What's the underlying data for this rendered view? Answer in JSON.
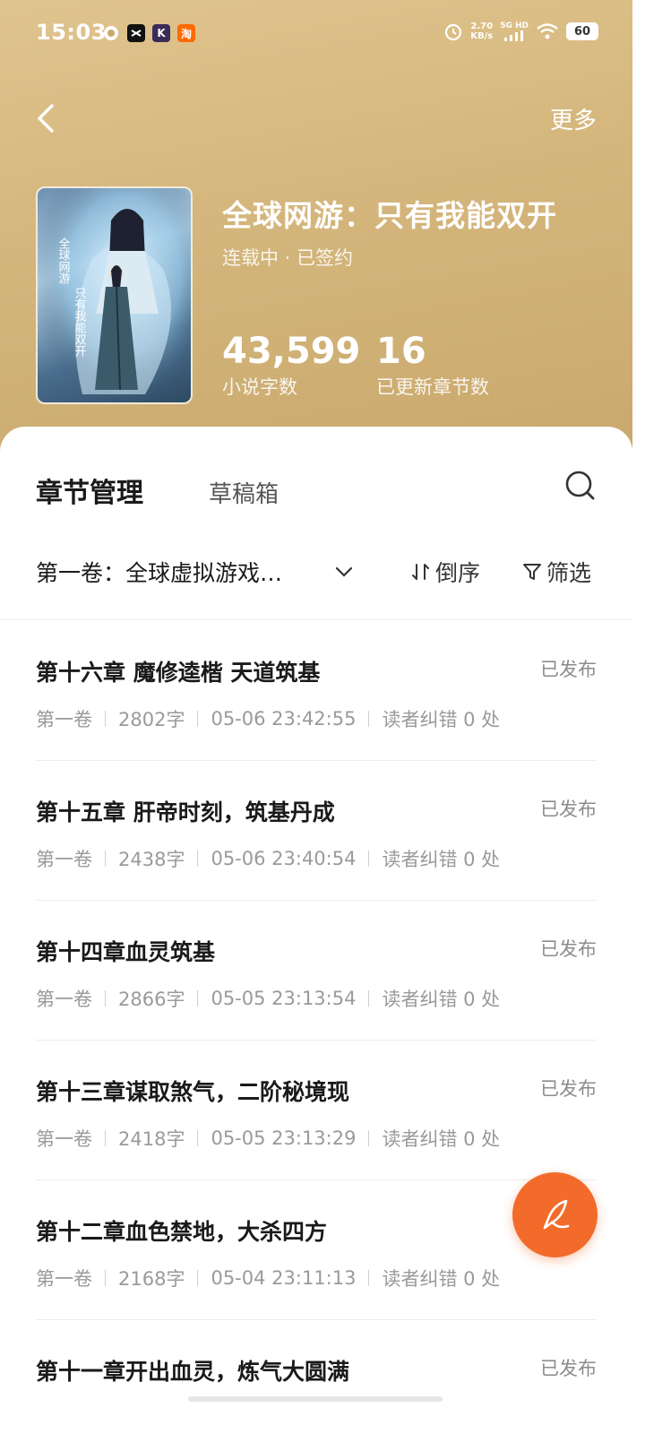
{
  "status_bar": {
    "time": "15:03",
    "speed_value": "2.70",
    "speed_unit": "KB/s",
    "network": "5G HD",
    "battery": "60"
  },
  "nav": {
    "more_label": "更多"
  },
  "book": {
    "title": "全球网游：只有我能双开",
    "status": "连载中 · 已签约",
    "word_count": "43,599",
    "word_count_label": "小说字数",
    "chapter_count": "16",
    "chapter_count_label": "已更新章节数"
  },
  "tabs": {
    "active": "章节管理",
    "inactive": "草稿箱"
  },
  "toolbar": {
    "volume": "第一卷：全球虚拟游戏…",
    "sort_label": "倒序",
    "filter_label": "筛选"
  },
  "chapters": [
    {
      "title": "第十六章 魔修逵楷 天道筑基",
      "status": "已发布",
      "volume": "第一卷",
      "words": "2802字",
      "time": "05-06 23:42:55",
      "errors": "读者纠错 0 处"
    },
    {
      "title": "第十五章 肝帝时刻，筑基丹成",
      "status": "已发布",
      "volume": "第一卷",
      "words": "2438字",
      "time": "05-06 23:40:54",
      "errors": "读者纠错 0 处"
    },
    {
      "title": "第十四章血灵筑基",
      "status": "已发布",
      "volume": "第一卷",
      "words": "2866字",
      "time": "05-05 23:13:54",
      "errors": "读者纠错 0 处"
    },
    {
      "title": "第十三章谋取煞气，二阶秘境现",
      "status": "已发布",
      "volume": "第一卷",
      "words": "2418字",
      "time": "05-05 23:13:29",
      "errors": "读者纠错 0 处"
    },
    {
      "title": "第十二章血色禁地，大杀四方",
      "status": "",
      "volume": "第一卷",
      "words": "2168字",
      "time": "05-04 23:11:13",
      "errors": "读者纠错 0 处"
    },
    {
      "title": "第十一章开出血灵，炼气大圆满",
      "status": "已发布",
      "volume": "",
      "words": "",
      "time": "",
      "errors": ""
    }
  ],
  "colors": {
    "header": "#d4b67c",
    "fab": "#f36b2a"
  }
}
